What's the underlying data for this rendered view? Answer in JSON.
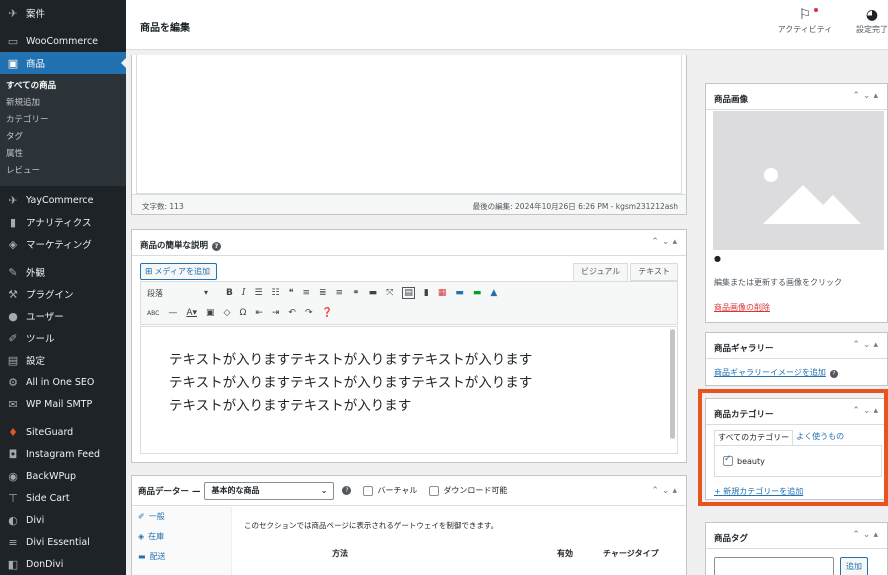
{
  "sidebar": {
    "top_items": [
      {
        "label": "案件",
        "icon": "pin-icon"
      },
      {
        "label": "WooCommerce",
        "icon": "woocommerce-icon"
      },
      {
        "label": "商品",
        "icon": "archive-icon",
        "current": true
      }
    ],
    "submenu": [
      "すべての商品",
      "新規追加",
      "カテゴリー",
      "タグ",
      "属性",
      "レビュー"
    ],
    "items": [
      {
        "label": "YayCommerce",
        "icon": "plane-icon"
      },
      {
        "label": "アナリティクス",
        "icon": "chart-icon"
      },
      {
        "label": "マーケティング",
        "icon": "megaphone-icon"
      },
      {
        "label": "外観",
        "icon": "brush-icon"
      },
      {
        "label": "プラグイン",
        "icon": "plugin-icon"
      },
      {
        "label": "ユーザー",
        "icon": "user-icon"
      },
      {
        "label": "ツール",
        "icon": "wrench-icon"
      },
      {
        "label": "設定",
        "icon": "settings-icon"
      },
      {
        "label": "All in One SEO",
        "icon": "seo-icon"
      },
      {
        "label": "WP Mail SMTP",
        "icon": "mail-icon"
      },
      {
        "label": "SiteGuard",
        "icon": "guard-icon"
      },
      {
        "label": "Instagram Feed",
        "icon": "instagram-icon"
      },
      {
        "label": "BackWPup",
        "icon": "backup-icon"
      },
      {
        "label": "Side Cart",
        "icon": "cart-icon"
      },
      {
        "label": "Divi",
        "icon": "divi-icon"
      },
      {
        "label": "Divi Essential",
        "icon": "divi-essential-icon"
      },
      {
        "label": "DonDivi",
        "icon": "dondivi-icon"
      }
    ]
  },
  "header": {
    "title": "商品を編集",
    "activity_label": "アクティビティ",
    "setup_label": "設定完了"
  },
  "editor": {
    "word_count": "文字数: 113",
    "last_edit": "最後の編集: 2024年10月26日 6:26 PM - kgsm231212ash"
  },
  "short_description": {
    "title": "商品の簡単な説明",
    "help": "?",
    "media_button": "メディアを追加",
    "tab_visual": "ビジュアル",
    "tab_text": "テキスト",
    "format_select": "段落",
    "content": [
      "テキストが入りますテキストが入りますテキストが入ります",
      "テキストが入りますテキストが入りますテキストが入ります",
      "テキストが入りますテキストが入ります"
    ]
  },
  "product_data": {
    "title": "商品データー —",
    "type_select": "基本的な商品",
    "virtual_label": "バーチャル",
    "download_label": "ダウンロード可能",
    "tabs": [
      {
        "label": "一般",
        "icon": "wrench-icon"
      },
      {
        "label": "在庫",
        "icon": "tag-icon"
      },
      {
        "label": "配送",
        "icon": "truck-icon"
      }
    ],
    "description": "このセクションでは商品ページに表示されるゲートウェイを制御できます。",
    "columns": [
      "方法",
      "有効",
      "チャージタイプ"
    ]
  },
  "product_image": {
    "title": "商品画像",
    "note": "編集または更新する画像をクリック",
    "remove_link": "商品画像の削除"
  },
  "gallery": {
    "title": "商品ギャラリー",
    "add_link": "商品ギャラリーイメージを追加"
  },
  "categories": {
    "title": "商品カテゴリー",
    "tab_all": "すべてのカテゴリー",
    "tab_popular": "よく使うもの",
    "items": [
      {
        "label": "beauty",
        "checked": true
      }
    ],
    "add_link": "+ 新規カテゴリーを追加"
  },
  "tags": {
    "title": "商品タグ",
    "add_button": "追加"
  },
  "colors": {
    "sidebar_bg": "#1d2327",
    "accent": "#2271b1",
    "highlight": "#e8541e",
    "danger": "#d63638"
  }
}
